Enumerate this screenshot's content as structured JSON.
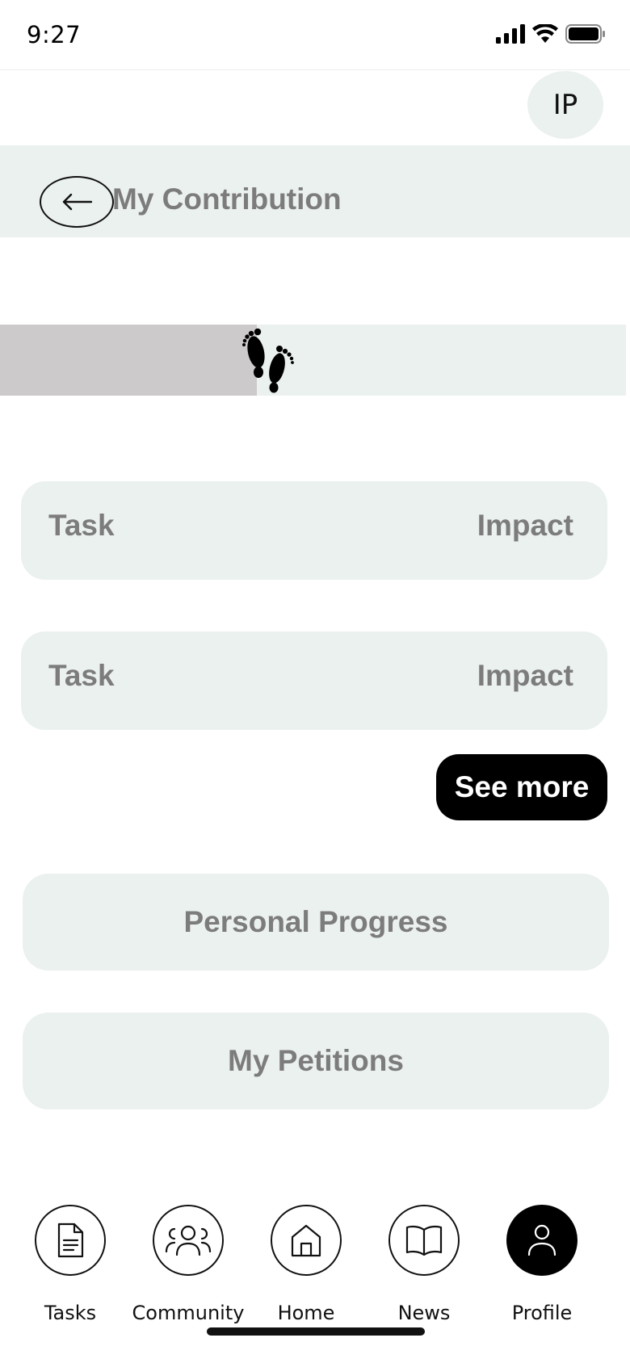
{
  "status_bar": {
    "time": "9:27"
  },
  "avatar": {
    "initials": "IP"
  },
  "header": {
    "title": "My Contribution"
  },
  "progress": {
    "value": 0.41
  },
  "tasks": [
    {
      "task": "Task",
      "impact": "Impact"
    },
    {
      "task": "Task",
      "impact": "Impact"
    }
  ],
  "see_more_label": "See more",
  "personal_progress_label": "Personal Progress",
  "my_petitions_label": "My Petitions",
  "nav": {
    "items": [
      {
        "label": "Tasks",
        "icon": "document-icon",
        "active": false
      },
      {
        "label": "Community",
        "icon": "people-icon",
        "active": false
      },
      {
        "label": "Home",
        "icon": "home-icon",
        "active": false
      },
      {
        "label": "News",
        "icon": "book-icon",
        "active": false
      },
      {
        "label": "Profile",
        "icon": "person-icon",
        "active": true
      }
    ]
  },
  "colors": {
    "panel": "#ebf1ee",
    "progress_fill": "#cdcacc",
    "muted_text": "#7c7c7c",
    "primary": "#000000"
  }
}
